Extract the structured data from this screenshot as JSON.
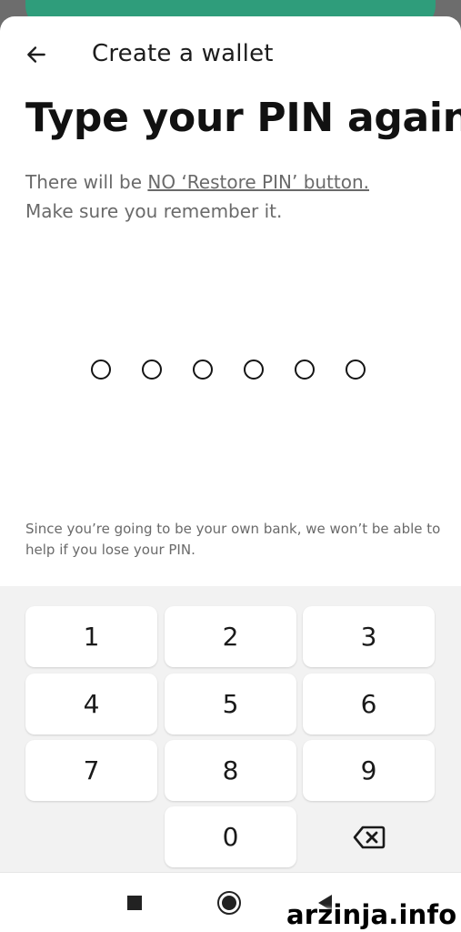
{
  "colors": {
    "accent": "#2f9d7b",
    "sheet_bg": "#ffffff",
    "keypad_bg": "#f2f2f2",
    "secondary_text": "#6a6a6a"
  },
  "header": {
    "back_icon": "arrow-left-icon",
    "title": "Create a wallet"
  },
  "main": {
    "heading": "Type your PIN again",
    "description_prefix": "There will be ",
    "description_link": "NO ‘Restore PIN’ button.",
    "description_line2": "Make sure you remember it.",
    "pin_length": 6,
    "pin_entered": 0,
    "note": "Since you’re going to be your own bank, we won’t be able to help if you lose your PIN."
  },
  "keypad": {
    "keys": [
      "1",
      "2",
      "3",
      "4",
      "5",
      "6",
      "7",
      "8",
      "9",
      "0"
    ],
    "backspace_icon": "backspace-icon"
  },
  "navbar": {
    "icons": [
      "recents-square-icon",
      "home-circle-icon",
      "back-triangle-icon"
    ]
  },
  "watermark": "arzinja.info"
}
